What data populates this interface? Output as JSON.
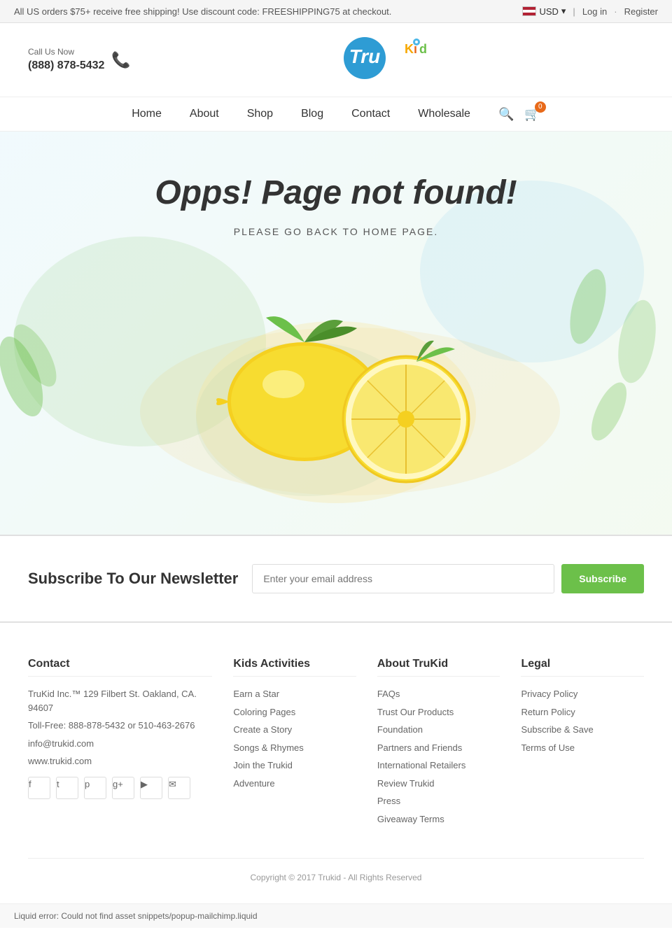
{
  "topBar": {
    "message": "All US orders $75+ receive free shipping! Use discount code: FREESHIPPING75 at checkout.",
    "currency": "USD",
    "loginLabel": "Log in",
    "registerLabel": "Register"
  },
  "header": {
    "callLabel": "Call Us Now",
    "phone": "(888) 878-5432",
    "logoText": "TruKid"
  },
  "nav": {
    "items": [
      {
        "label": "Home",
        "href": "#"
      },
      {
        "label": "About",
        "href": "#"
      },
      {
        "label": "Shop",
        "href": "#"
      },
      {
        "label": "Blog",
        "href": "#"
      },
      {
        "label": "Contact",
        "href": "#"
      },
      {
        "label": "Wholesale",
        "href": "#"
      }
    ],
    "cartCount": "0"
  },
  "errorPage": {
    "title": "Opps! Page not found!",
    "subtitle": "PLEASE GO BACK TO HOME PAGE."
  },
  "newsletter": {
    "title": "Subscribe To Our Newsletter",
    "inputPlaceholder": "Enter your email address",
    "buttonLabel": "Subscribe"
  },
  "footer": {
    "contact": {
      "title": "Contact",
      "address": "TruKid Inc.™ 129 Filbert St. Oakland, CA. 94607",
      "tollfree": "Toll-Free: 888-878-5432 or 510-463-2676",
      "email": "info@trukid.com",
      "website": "www.trukid.com",
      "socialIcons": [
        "f",
        "t",
        "p",
        "g+",
        "▶",
        "✉"
      ]
    },
    "kidsActivities": {
      "title": "Kids Activities",
      "links": [
        "Earn a Star",
        "Coloring Pages",
        "Create a Story",
        "Songs & Rhymes",
        "Join the Trukid",
        "Adventure"
      ]
    },
    "aboutTrukid": {
      "title": "About TruKid",
      "links": [
        "FAQs",
        "Trust Our Products",
        "Foundation",
        "Partners and Friends",
        "International Retailers",
        "Review Trukid",
        "Press",
        "Giveaway Terms"
      ]
    },
    "legal": {
      "title": "Legal",
      "links": [
        "Privacy Policy",
        "Return Policy",
        "Subscribe & Save",
        "Terms of Use"
      ]
    },
    "copyright": "Copyright © 2017 Trukid - All Rights Reserved"
  },
  "errorNotice": "Liquid error: Could not find asset snippets/popup-mailchimp.liquid"
}
